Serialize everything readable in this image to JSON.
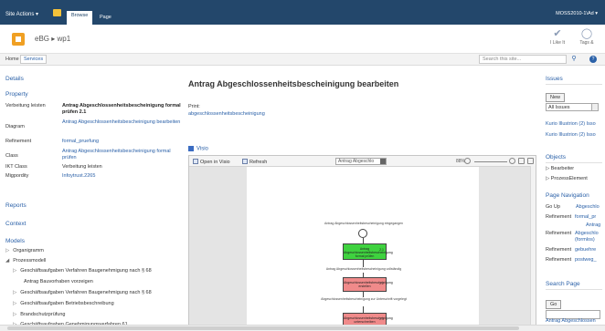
{
  "topbar": {
    "site_actions": "Site Actions ▾",
    "tab_browse": "Browse",
    "tab_page": "Page",
    "user": "MOSS2010-1\\Ad ▾"
  },
  "title": {
    "breadcrumb": "eBG ▸ wp1",
    "like_it": "I Like It",
    "tags": "Tags &"
  },
  "nav": {
    "home": "Home",
    "services": "Services",
    "search_placeholder": "Search this site..."
  },
  "left": {
    "details": "Details",
    "property": "Property",
    "props": [
      {
        "k": "Verbeitung leisten",
        "v": "Antrag Abgeschlossenheitsbescheinigung formal prüfen 2.1"
      },
      {
        "k": "Diagram",
        "v": "Antrag Abgeschlossenheitsbescheinigung bearbeiten"
      },
      {
        "k": "Refinement",
        "v": "formal_pruefung"
      },
      {
        "k": "Class",
        "v": "Antrag Abgeschlossenheitsbescheinigung formal prüfen"
      },
      {
        "k": "IKT Class",
        "v": "Verbeitung leisten"
      },
      {
        "k": "Migpordity",
        "v": "Infoytrust.2265"
      }
    ],
    "reports": "Reports",
    "context": "Context",
    "models": "Models",
    "tree": [
      "Organigramm",
      "Prozessmodell",
      "Geschäftsaufgaben Verfahren Baugenehmigung nach § 68",
      "Antrag Bauvorhaben vorzeigen",
      "Geschäftsaufgaben Verfahren Baugenehmigung nach § 68",
      "Geschäftsaufgaben Betriebsbeschreibung",
      "Brandschutzprüfung",
      "Geschäftsaufgaben Genehmigungsverfahren 61"
    ]
  },
  "main": {
    "title": "Antrag Abgeschlossenheitsbescheinigung bearbeiten",
    "print_label": "Print:",
    "print_link": "abgeschlossenheitsbescheinigung",
    "visio_label": "Visio",
    "toolbar": {
      "open_visio": "Open in Visio",
      "refresh": "Refresh",
      "select": "Antrag Abgeschlo",
      "zoom": "88%"
    },
    "flow": {
      "top_text": "Antrag Abgeschlossenheitsbescheinigung eingegangen",
      "box1": "Antrag Abgeschlossenheitsbescheinigung formal prüfen",
      "box1_num": "2.1",
      "text2": "Antrag Abgeschlossenheitsbescheinigung vollständig",
      "box2": "Abgeschlossenheitsbescheinigung erstellen",
      "box2_num": "2.2",
      "text3": "Abgeschlossenheitsbescheinigung zur Unterschrift vorgelegt",
      "box3": "Abgeschlossenheitsbescheinigung unterschreiben",
      "box3_num": "2.3"
    }
  },
  "right": {
    "issues": "Issues",
    "new_btn": "New",
    "issues_filter": "All Issues",
    "issue_links": [
      "Kurio Illustrion (2) Isso",
      "Kurio Illustrion (2) Isso"
    ],
    "objects": "Objects",
    "object_items": [
      "Bearbeiter",
      "ProzessElement"
    ],
    "page_nav": "Page Navigation",
    "go_up": "Go Up",
    "go_up_link": "Abgeschlo",
    "refinement1_label": "Refinement",
    "refinement1_link": "formal_pr",
    "antrag_text": "Antrag",
    "refinement2_label": "Refinement",
    "refinement2_link": "Abgeschlo (formlos)",
    "refinement3_label": "Refinement",
    "refinement3_link": "gebuehre",
    "refinement4_label": "Refinement",
    "refinement4_link": "postweg_",
    "search_page": "Search Page",
    "go_btn": "Go",
    "bottom_link": "Antrag Abgeschlossen"
  }
}
